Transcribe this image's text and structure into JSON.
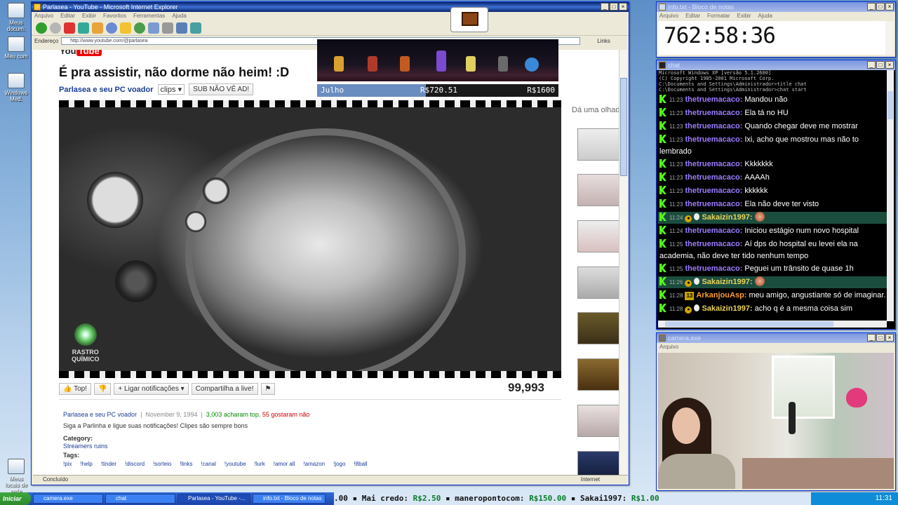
{
  "desktop": {
    "icons": [
      "Meus docum.",
      "Meu com",
      "Windows Med.",
      "Meus locais de rede"
    ]
  },
  "ie": {
    "title": "Parlasea - YouTube - Microsoft Internet Explorer",
    "menu": [
      "Arquivo",
      "Editar",
      "Exibir",
      "Favoritos",
      "Ferramentas",
      "Ajuda"
    ],
    "address_label": "Endereço",
    "address": "http://www.youtube.com/@parlasea",
    "links_label": "Links",
    "status_left": "Concluído",
    "status_zone": "Internet"
  },
  "youtube": {
    "logo_you": "You",
    "logo_tube": "Tube",
    "video_title": "É pra assistir, não dorme não heim! :D",
    "channel": "Parlasea e seu PC voador",
    "clips_label": "clips",
    "sub_button": "SUB NÃO VÊ AD!",
    "watermark_line1": "RASTRO",
    "watermark_line2": "QUÍMICO",
    "like_label": "Top!",
    "notify_label": "Ligar notificações",
    "share_label": "Compartilha a live!",
    "views": "99,993",
    "desc_channel": "Parlasea e seu PC voador",
    "desc_date": "November 9, 1994",
    "desc_likes": "3,003 acharam top",
    "desc_dislikes": "55 gostaram não",
    "desc_text": "Siga a Parlinha e ligue suas notificações! Clipes são sempre bons",
    "category_label": "Category:",
    "category_value": "Streamers ruins",
    "tags_label": "Tags:",
    "tags": [
      "!pix",
      "!help",
      "!tinder",
      "!discord",
      "!sorteio",
      "!links",
      "!canal",
      "!youtube",
      "!lurk",
      "!amor all",
      "!amazon",
      "!jogo",
      "!8ball"
    ],
    "side_header": "Dá uma olhada"
  },
  "game_overlay": {
    "month": "Julho",
    "current": "R$720.51",
    "goal": "R$1600",
    "progress_fraction": 0.45
  },
  "notepad": {
    "title": "info.txt - Bloco de notas",
    "menu": [
      "Arquivo",
      "Editar",
      "Formatar",
      "Exibir",
      "Ajuda"
    ],
    "timer": "762:58:36"
  },
  "chat": {
    "title": "chat",
    "console_lines": [
      "Microsoft Windows XP [versão 5.1.2600]",
      "(C) Copyright 1985-2001 Microsoft Corp.",
      "",
      "C:\\Documents and Settings\\Administrador>title chat",
      "",
      "C:\\Documents and Settings\\Administrador>chat start"
    ],
    "messages": [
      {
        "time": "11:23",
        "user": "thetruemacaco:",
        "text": "Mandou não",
        "style": "purple"
      },
      {
        "time": "11:23",
        "user": "thetruemacaco:",
        "text": "Ela tá no HU",
        "style": "purple"
      },
      {
        "time": "11:23",
        "user": "thetruemacaco:",
        "text": "Quando chegar deve me mostrar",
        "style": "purple"
      },
      {
        "time": "11:23",
        "user": "thetruemacaco:",
        "text": "Ixi, acho que mostrou mas não to lembrado",
        "style": "purple"
      },
      {
        "time": "11:23",
        "user": "thetruemacaco:",
        "text": "Kkkkkkk",
        "style": "purple"
      },
      {
        "time": "11:23",
        "user": "thetruemacaco:",
        "text": "AAAAh",
        "style": "purple"
      },
      {
        "time": "11:23",
        "user": "thetruemacaco:",
        "text": "kkkkkk",
        "style": "purple"
      },
      {
        "time": "11:23",
        "user": "thetruemacaco:",
        "text": "Ela não deve ter visto",
        "style": "purple"
      },
      {
        "time": "11:24",
        "user": "Sakaizin1997:",
        "text": "",
        "style": "yellow",
        "highlight": true
      },
      {
        "time": "11:24",
        "user": "thetruemacaco:",
        "text": "Iniciou estágio num novo hospital",
        "style": "purple"
      },
      {
        "time": "11:25",
        "user": "thetruemacaco:",
        "text": "Aí dps do hospital eu levei ela na academia, não deve ter tido nenhum tempo",
        "style": "purple"
      },
      {
        "time": "11:25",
        "user": "thetruemacaco:",
        "text": "Peguei um trânsito de quase 1h",
        "style": "purple"
      },
      {
        "time": "11:26",
        "user": "Sakaizin1997:",
        "text": "",
        "style": "yellow",
        "highlight": true
      },
      {
        "time": "11:28",
        "user": "ArkanjouAsp:",
        "text": "meu amigo, angustiante só de imaginar.",
        "style": "orange",
        "sub": "13"
      },
      {
        "time": "11:28",
        "user": "Sakaizin1997:",
        "text": "acho q é a mesma coisa sim",
        "style": "yellow"
      }
    ]
  },
  "camera": {
    "title": "camera.exe",
    "menu": [
      "Arquivo"
    ]
  },
  "taskbar": {
    "start": "Iniciar",
    "tasks": [
      "camera.exe",
      "chat",
      "Parlasea - YouTube -...",
      "info.txt - Bloco de notas"
    ],
    "ticker_parts": [
      {
        "text": ".00 ▪ Mai credo: ",
        "amt": "R$2.50"
      },
      {
        "text": " ▪ maneropontocom: ",
        "amt": "R$150.00"
      },
      {
        "text": " ▪ Sakai1997: ",
        "amt": "R$1.00"
      }
    ],
    "clock": "11:31"
  },
  "colors": {
    "accent": "#0a246a",
    "kick_green": "#53fc18",
    "user_purple": "#9c7cff",
    "highlight_bg": "#1b4d3e"
  }
}
